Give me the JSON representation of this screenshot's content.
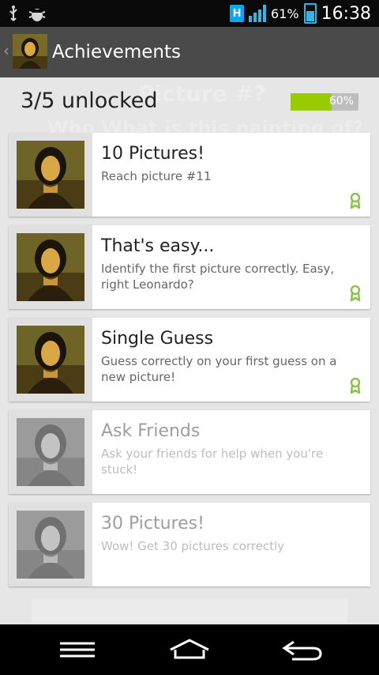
{
  "status": {
    "network_badge": "H",
    "battery_percent": "61%",
    "time": "16:38"
  },
  "header": {
    "title": "Achievements"
  },
  "summary": {
    "unlocked_text": "3/5 unlocked",
    "progress_label": "60%",
    "progress_fraction": 0.6
  },
  "background_watermark": {
    "line1": "Picture #?",
    "line2": "Who What is this painting of?"
  },
  "achievements": [
    {
      "name": "10 Pictures!",
      "description": "Reach picture #11",
      "unlocked": true
    },
    {
      "name": "That's easy...",
      "description": "Identify the first picture correctly. Easy, right Leonardo?",
      "unlocked": true
    },
    {
      "name": "Single Guess",
      "description": "Guess correctly on your first guess on a new picture!",
      "unlocked": true
    },
    {
      "name": "Ask Friends",
      "description": "Ask your friends for help when you're stuck!",
      "unlocked": false
    },
    {
      "name": "30 Pictures!",
      "description": "Wow! Get 30 pictures correctly",
      "unlocked": false
    }
  ],
  "icons": {
    "usb": "usb-icon",
    "debug": "android-debug-icon",
    "award": "award-ribbon-icon",
    "nav_menu": "menu-icon",
    "nav_home": "home-icon",
    "nav_back": "back-icon"
  },
  "colors": {
    "accent_green": "#99cc00",
    "signal_blue": "#33b5e5",
    "award_green": "#8bc34a"
  }
}
